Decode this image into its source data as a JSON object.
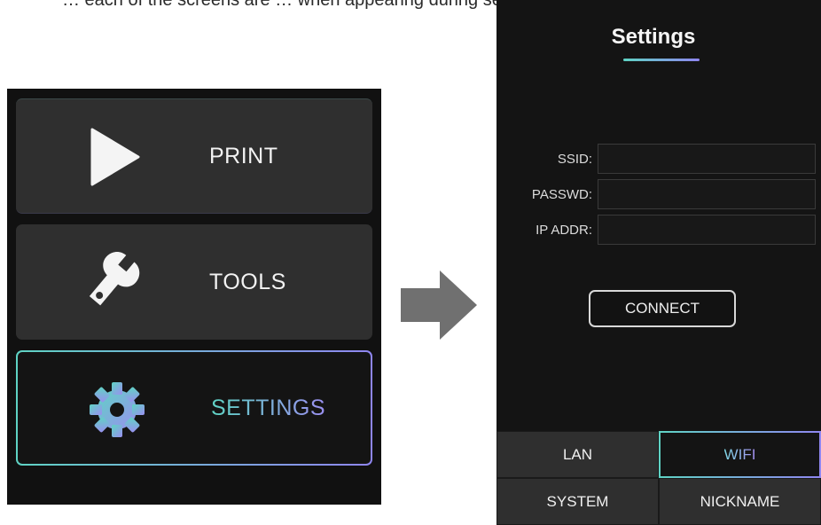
{
  "caption": "… each of the screens are …  when appearing during setup of the …",
  "main_menu": {
    "items": [
      {
        "label": "PRINT",
        "icon": "play-icon"
      },
      {
        "label": "TOOLS",
        "icon": "wrench-icon"
      },
      {
        "label": "SETTINGS",
        "icon": "gear-icon",
        "selected": true
      }
    ]
  },
  "arrow_icon": "right-arrow-icon",
  "settings": {
    "title": "Settings",
    "fields": [
      {
        "label": "SSID:",
        "value": ""
      },
      {
        "label": "PASSWD:",
        "value": ""
      },
      {
        "label": "IP ADDR:",
        "value": ""
      }
    ],
    "connect_label": "CONNECT",
    "tabs": [
      {
        "label": "LAN"
      },
      {
        "label": "WIFI",
        "active": true
      },
      {
        "label": "SYSTEM"
      },
      {
        "label": "NICKNAME"
      }
    ]
  },
  "colors": {
    "accent_start": "#5fd3c4",
    "accent_end": "#8f86f0",
    "panel_bg": "#111111",
    "button_bg": "#2f2f2f"
  }
}
